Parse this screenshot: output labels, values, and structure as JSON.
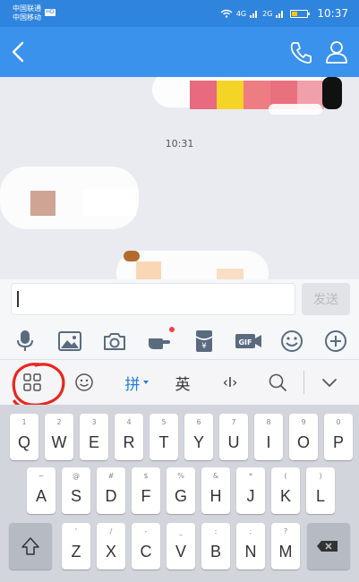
{
  "status_bar": {
    "carrier1": "中国联通",
    "carrier2": "中国移动",
    "hd": "HD",
    "net": "4G",
    "net2": "2G",
    "time": "10:37"
  },
  "chat": {
    "timestamp": "10:31"
  },
  "input": {
    "value": "",
    "send_label": "发送"
  },
  "ime": {
    "pinyin_label": "拼",
    "english_label": "英",
    "cursor_label": "‹I›"
  },
  "keyboard": {
    "row1": [
      {
        "hint": "1",
        "key": "Q"
      },
      {
        "hint": "2",
        "key": "W"
      },
      {
        "hint": "3",
        "key": "E"
      },
      {
        "hint": "4",
        "key": "R"
      },
      {
        "hint": "5",
        "key": "T"
      },
      {
        "hint": "6",
        "key": "Y"
      },
      {
        "hint": "7",
        "key": "U"
      },
      {
        "hint": "8",
        "key": "I"
      },
      {
        "hint": "9",
        "key": "O"
      },
      {
        "hint": "0",
        "key": "P"
      }
    ],
    "row2": [
      {
        "hint": "~",
        "key": "A"
      },
      {
        "hint": "@",
        "key": "S"
      },
      {
        "hint": "#",
        "key": "D"
      },
      {
        "hint": "$",
        "key": "F"
      },
      {
        "hint": "%",
        "key": "G"
      },
      {
        "hint": "&",
        "key": "H"
      },
      {
        "hint": "*",
        "key": "J"
      },
      {
        "hint": "(",
        "key": "K"
      },
      {
        "hint": ")",
        "key": "L"
      }
    ],
    "row3": [
      {
        "hint": "'",
        "key": "Z"
      },
      {
        "hint": "/",
        "key": "X"
      },
      {
        "hint": "-",
        "key": "C"
      },
      {
        "hint": "_",
        "key": "V"
      },
      {
        "hint": ":",
        "key": "B"
      },
      {
        "hint": ";",
        "key": "N"
      },
      {
        "hint": "?",
        "key": "M"
      }
    ]
  },
  "colors": {
    "header": "#3a92ec",
    "status_bar": "#2f84de",
    "ime_active": "#1f7fe0",
    "annotation": "#e8261f"
  }
}
